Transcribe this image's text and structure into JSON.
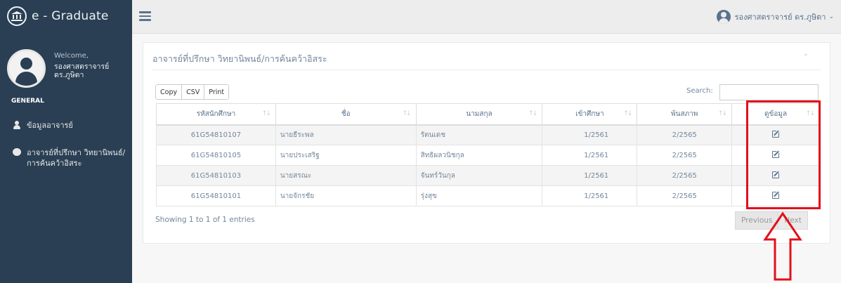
{
  "app": {
    "brand": "e - Graduate"
  },
  "sidebar": {
    "welcome": "Welcome,",
    "user_name": "รองศาสตราจารย์ ดร.ภูษิตา",
    "section": "GENERAL",
    "items": [
      {
        "label": "ข้อมูลอาจารย์",
        "icon": "user-icon"
      },
      {
        "label": "อาจารย์ที่ปรึกษา วิทยานิพนธ์/การค้นคว้าอิสระ",
        "icon": "circle-icon"
      }
    ]
  },
  "topbar": {
    "user": "รองศาสตราจารย์ ดร.ภูษิตา"
  },
  "panel": {
    "title": "อาจารย์ที่ปรึกษา วิทยานิพนธ์/การค้นคว้าอิสระ",
    "buttons": [
      "Copy",
      "CSV",
      "Print"
    ],
    "search_label": "Search:",
    "search_value": "",
    "columns": [
      "รหัสนักศึกษา",
      "ชื่อ",
      "นามสกุล",
      "เข้าศึกษา",
      "พ้นสภาพ",
      "ดูข้อมูล"
    ],
    "rows": [
      {
        "id": "61G54810107",
        "first": "นายธีระพล",
        "last": "รัตนเดช",
        "enter": "1/2561",
        "exit": "2/2565"
      },
      {
        "id": "61G54810105",
        "first": "นายประเสริฐ",
        "last": "สิทธิผลวนิชกุล",
        "enter": "1/2561",
        "exit": "2/2565"
      },
      {
        "id": "61G54810103",
        "first": "นายสรณะ",
        "last": "จันทร์วันกุล",
        "enter": "1/2561",
        "exit": "2/2565"
      },
      {
        "id": "61G54810101",
        "first": "นายจักรชัย",
        "last": "รุ่งสุข",
        "enter": "1/2561",
        "exit": "2/2565"
      }
    ],
    "info": "Showing 1 to 1 of 1 entries",
    "previous": "Previous",
    "next": "Next"
  },
  "colors": {
    "sidebar_bg": "#2a3f54",
    "highlight": "#e2101a",
    "text": "#73879c"
  }
}
